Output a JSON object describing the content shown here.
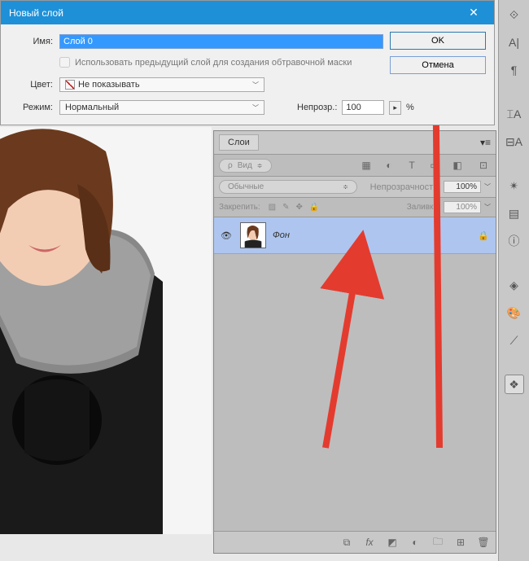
{
  "dialog": {
    "title": "Новый слой",
    "name_label": "Имя:",
    "name_value": "Слой 0",
    "clipmask_label": "Использовать предыдущий слой для создания обтравочной маски",
    "color_label": "Цвет:",
    "color_value": "Не показывать",
    "mode_label": "Режим:",
    "mode_value": "Нормальный",
    "opacity_label": "Непрозр.:",
    "opacity_value": "100",
    "opacity_suffix": "%",
    "ok_label": "OK",
    "cancel_label": "Отмена"
  },
  "layers_panel": {
    "tab_label": "Слои",
    "kind_filter": "Вид",
    "blend_mode": "Обычные",
    "opacity_label": "Непрозрачность:",
    "opacity_value": "100%",
    "lock_label": "Закрепить:",
    "fill_label": "Заливка:",
    "fill_value": "100%",
    "layer_items": [
      {
        "name": "Фон"
      }
    ]
  },
  "colors": {
    "dialog_header": "#1e90d8",
    "arrow": "#e43b2f",
    "layer_selected": "#aec6ef"
  }
}
